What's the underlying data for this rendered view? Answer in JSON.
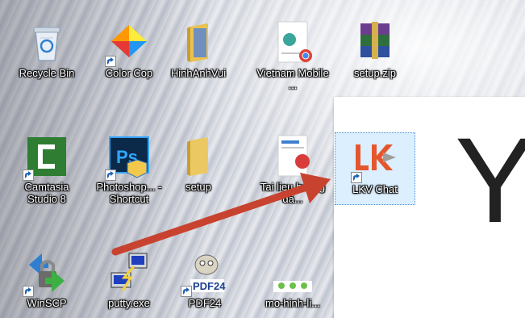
{
  "desktop": {
    "icons": [
      {
        "label": "Recycle Bin",
        "icon": "recycle-bin-icon"
      },
      {
        "label": "Color Cop",
        "icon": "color-cop-icon"
      },
      {
        "label": "HinhAnhVui",
        "icon": "folder-icon"
      },
      {
        "label": "Vietnam Mobile ...",
        "icon": "document-icon"
      },
      {
        "label": "setup.zip",
        "icon": "winrar-archive-icon"
      },
      {
        "label": "Camtasia Studio 8",
        "icon": "camtasia-icon"
      },
      {
        "label": "Photoshop... - Shortcut",
        "icon": "photoshop-icon"
      },
      {
        "label": "setup",
        "icon": "folder-icon"
      },
      {
        "label": "Tai lieu huong dẫ...",
        "icon": "document-icon"
      },
      {
        "label": "LKV Chat",
        "icon": "lkv-chat-icon"
      },
      {
        "label": "WinSCP",
        "icon": "winscp-icon"
      },
      {
        "label": "putty.exe",
        "icon": "putty-icon"
      },
      {
        "label": "PDF24",
        "icon": "pdf24-icon"
      },
      {
        "label": "mo-hinh-li...",
        "icon": "image-icon"
      }
    ]
  },
  "window": {
    "big_letter": "Y"
  },
  "colors": {
    "arrow": "#c8432f",
    "lkv_orange": "#e4572e",
    "selection": "#99d1ff"
  },
  "logo_text": {
    "pdf24": "PDF24",
    "photoshop": "Ps"
  }
}
